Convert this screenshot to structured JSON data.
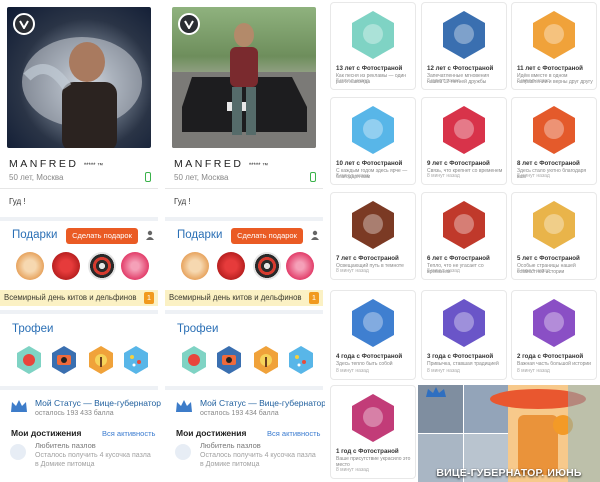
{
  "profiles": [
    {
      "name": "MANFRED",
      "stars": "***** ™",
      "info": "50 лет, Москва",
      "greeting": "Гуд !",
      "gifts_title": "Подарки",
      "gift_button": "Сделать подарок",
      "holiday": "Всемирный день китов и дельфинов",
      "holiday_badge": "1",
      "trophies_title": "Трофеи",
      "status_title": "Мой Статус — Вице-губернатор",
      "status_sub": "осталось 193 433 балла",
      "achievements_title": "Мои достижения",
      "achievements_link": "Вся активность",
      "achievement_name": "Любитель пазлов",
      "achievement_sub": "Осталось получить 4 кусочка пазла в Домике питомца"
    },
    {
      "name": "MANFRED",
      "stars": "***** ™",
      "info": "50 лет, Москва",
      "greeting": "Гуд !",
      "gifts_title": "Подарки",
      "gift_button": "Сделать подарок",
      "holiday": "Всемирный день китов и дельфинов",
      "holiday_badge": "1",
      "trophies_title": "Трофеи",
      "status_title": "Мой Статус — Вице-губернатор",
      "status_sub": "осталось 193 434 балла",
      "achievements_title": "Мои достижения",
      "achievements_link": "Вся активность",
      "achievement_name": "Любитель пазлов",
      "achievement_sub": "Осталось получить 4 кусочка пазла в Домике питомца"
    }
  ],
  "trophy_cards": [
    {
      "title": "13 лет с Фотострaной",
      "desc": "Как песня из рекламы — один раз и навсегда",
      "time": "8 минут назад",
      "icon": "music-note-icon",
      "color": "#7fd3c4"
    },
    {
      "title": "12 лет с Фотостраной",
      "desc": "Запечатленные мгновения нашей 12-летней дружбы",
      "time": "8 минут назад",
      "icon": "camera-icon",
      "color": "#3a6fb0"
    },
    {
      "title": "11 лет с Фотостраной",
      "desc": "Идём вместе в одном направлении и верны друг другу",
      "time": "8 минут назад",
      "icon": "palm-sunset-icon",
      "color": "#f0a23a"
    },
    {
      "title": "10 лет с Фотостраной",
      "desc": "С каждым годом здесь ярче — благодаря вам",
      "time": "8 минут назад",
      "icon": "confetti-icon",
      "color": "#58b6e8"
    },
    {
      "title": "9 лет с Фотостраной",
      "desc": "Связь, что крепнет со временем",
      "time": "8 минут назад",
      "icon": "heart-link-icon",
      "color": "#d8334a"
    },
    {
      "title": "8 лет с Фотостраной",
      "desc": "Здесь стало уютно благодаря вам",
      "time": "8 минут назад",
      "icon": "armchair-icon",
      "color": "#e45a2b"
    },
    {
      "title": "7 лет с Фотостраной",
      "desc": "Освещающий путь в темноте",
      "time": "8 минут назад",
      "icon": "lantern-icon",
      "color": "#7b3a24"
    },
    {
      "title": "6 лет с Фотостраной",
      "desc": "Тепло, что не угасает со временем",
      "time": "8 минут назад",
      "icon": "fire-icon",
      "color": "#c0392b"
    },
    {
      "title": "5 лет с Фотостраной",
      "desc": "Особые страницы нашей совместной истории",
      "time": "8 минут назад",
      "icon": "book-icon",
      "color": "#e9b44a"
    },
    {
      "title": "4 года с Фотостраной",
      "desc": "Здесь тепло быть собой",
      "time": "8 минут назад",
      "icon": "heart-icon",
      "color": "#3f7fd0"
    },
    {
      "title": "3 года с Фотостраной",
      "desc": "Привычка, ставшая традицией",
      "time": "8 минут назад",
      "icon": "coffee-icon",
      "color": "#6a55c8"
    },
    {
      "title": "2 года с Фотостраной",
      "desc": "Важная часть большой истории",
      "time": "8 минут назад",
      "icon": "puzzle-icon",
      "color": "#8a4fc5"
    },
    {
      "title": "1 год с Фотостраной",
      "desc": "Ваше присутствие украсило это место",
      "time": "8 минут назад",
      "icon": "flower-icon",
      "color": "#c23c78"
    }
  ],
  "promo": {
    "caption": "ВИЦЕ-ГУБЕРНАТОР. ИЮНЬ"
  }
}
